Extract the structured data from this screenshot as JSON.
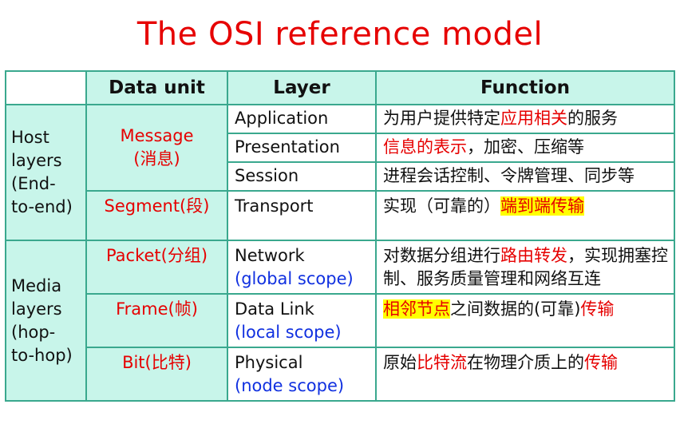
{
  "title": "The OSI reference model",
  "headers": {
    "corner": "",
    "data_unit": "Data unit",
    "layer": "Layer",
    "function": "Function"
  },
  "groups": {
    "host": {
      "line1": "Host",
      "line2": "layers",
      "line3": "(End-",
      "line4": "to-end)"
    },
    "media": {
      "line1": "Media",
      "line2": "layers",
      "line3": "(hop-",
      "line4": "to-hop)"
    }
  },
  "units": {
    "message_1": "Message",
    "message_2": "(消息)",
    "segment": "Segment(段)",
    "packet": "Packet(分组)",
    "frame": "Frame(帧)",
    "bit": "Bit(比特)"
  },
  "layers": {
    "application": "Application",
    "presentation": "Presentation",
    "session": "Session",
    "transport": "Transport",
    "network": "Network",
    "network_scope": "(global scope)",
    "datalink": "Data Link",
    "datalink_scope": "(local scope)",
    "physical": "Physical",
    "physical_scope": "(node scope)"
  },
  "functions": {
    "application": {
      "a": "为用户提供特定",
      "b": "应用相关",
      "c": "的服务"
    },
    "presentation": {
      "a": "信息的表示",
      "b": "，加密、压缩等"
    },
    "session": {
      "a": "进程会话控制、令牌管理、同步等"
    },
    "transport": {
      "a": "实现（可靠的）",
      "b": "端到端传输"
    },
    "network": {
      "a": "对数据分组进行",
      "b": "路由转发",
      "c": "，实现拥塞控制、服务质量管理和网络互连"
    },
    "datalink": {
      "a": "相邻节点",
      "b": "之间数据的(可靠)",
      "c": "传输"
    },
    "physical": {
      "a": "原始",
      "b": "比特流",
      "c": "在物理介质上的",
      "d": "传输"
    }
  },
  "colors": {
    "title": "#e60000",
    "border": "#3aa88e",
    "cell_fill": "#c8f5ea",
    "scope": "#1030e0",
    "highlight": "#ffff00"
  }
}
